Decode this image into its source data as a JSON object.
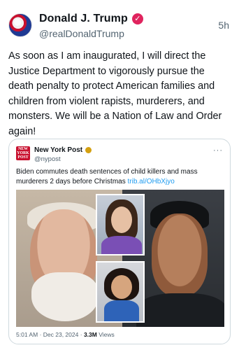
{
  "post": {
    "author": {
      "display_name": "Donald J. Trump",
      "handle": "@realDonaldTrump",
      "verified_badge_color": "#e0245e",
      "verified_icon": "checkmark-icon"
    },
    "time_ago": "5h",
    "text": "As soon as I am inaugurated, I will direct the Justice Department to vigorously pursue the death penalty to protect American families and children from violent rapists, murderers, and monsters. We will be a Nation of Law and Order again!"
  },
  "quoted_post": {
    "logo_text": "NEW YORK POST",
    "name": "New York Post",
    "handle": "@nypost",
    "verified_badge_color": "#d4a011",
    "more_icon": "···",
    "text": "Biden commutes death sentences of child killers and mass murderers 2 days before Christmas ",
    "link": "trib.al/OHbXjyo",
    "meta": {
      "time": "5:01 AM",
      "separator": "·",
      "date": "Dec 23, 2024",
      "views_count": "3.3M",
      "views_label": "Views"
    }
  },
  "colors": {
    "text": "#0f1419",
    "secondary": "#536471",
    "link": "#1d9bf0",
    "border": "#cfd9de"
  }
}
